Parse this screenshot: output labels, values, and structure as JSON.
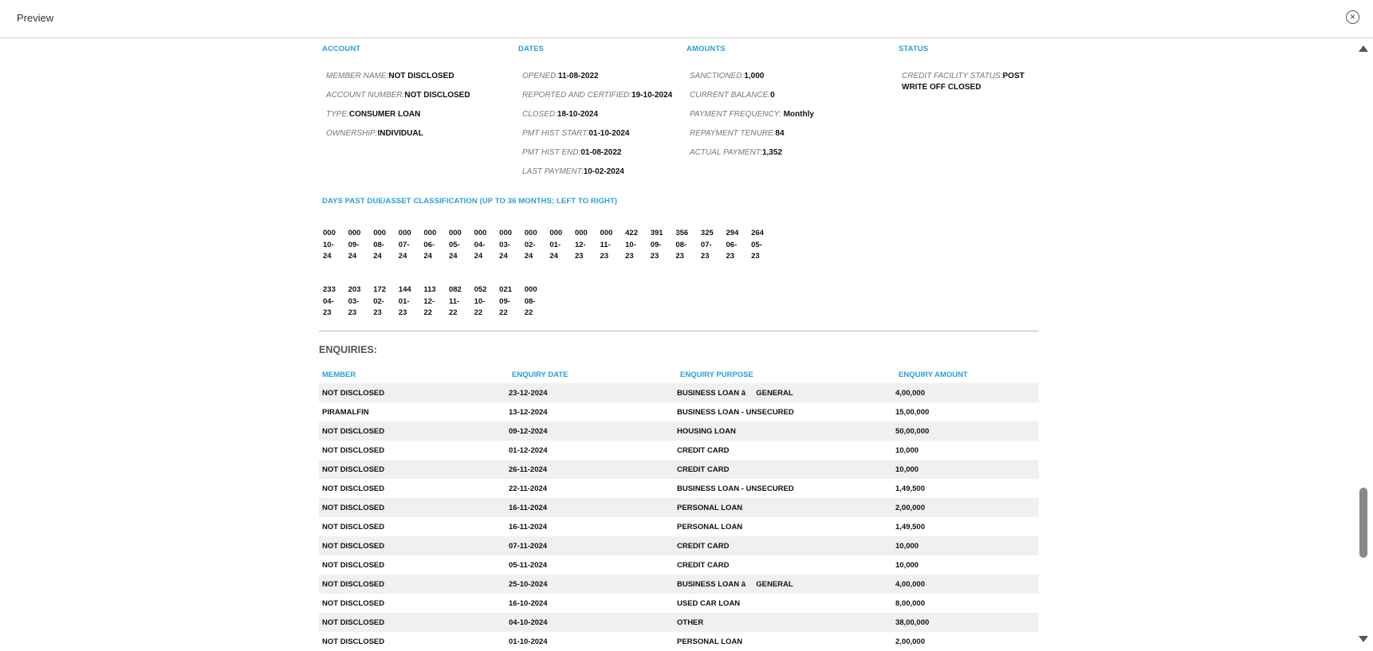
{
  "window": {
    "title": "Preview",
    "close_icon": "close-icon"
  },
  "headers": {
    "account": "ACCOUNT",
    "dates": "DATES",
    "amounts": "AMOUNTS",
    "status": "STATUS"
  },
  "account": [
    {
      "key": "MEMBER NAME:",
      "value": "NOT DISCLOSED"
    },
    {
      "key": "ACCOUNT NUMBER:",
      "value": "NOT DISCLOSED"
    },
    {
      "key": "TYPE:",
      "value": "CONSUMER LOAN"
    },
    {
      "key": "OWNERSHIP:",
      "value": "INDIVIDUAL"
    }
  ],
  "dates": [
    {
      "key": "OPENED:",
      "value": "11-08-2022"
    },
    {
      "key": "REPORTED AND CERTIFIED:",
      "value": "19-10-2024"
    },
    {
      "key": "CLOSED:",
      "value": "18-10-2024"
    },
    {
      "key": "PMT HIST START:",
      "value": "01-10-2024"
    },
    {
      "key": "PMT HIST END:",
      "value": "01-08-2022"
    },
    {
      "key": "LAST PAYMENT:",
      "value": "10-02-2024"
    }
  ],
  "amounts": [
    {
      "key": "SANCTIONED:",
      "value": "1,000"
    },
    {
      "key": "CURRENT BALANCE:",
      "value": "0"
    },
    {
      "key": "PAYMENT FREQUENCY:",
      "value": " Monthly"
    },
    {
      "key": "REPAYMENT TENURE:",
      "value": "84"
    },
    {
      "key": "ACTUAL PAYMENT:",
      "value": "1,352"
    }
  ],
  "status": {
    "key": "CREDIT FACILITY STATUS:",
    "value": "POST WRITE OFF CLOSED"
  },
  "dpd": {
    "title": "DAYS PAST DUE/ASSET CLASSIFICATION (UP TO 36 MONTHS; LEFT TO RIGHT)",
    "row1": [
      {
        "dpd": "000",
        "mm": "10-",
        "yy": "24"
      },
      {
        "dpd": "000",
        "mm": "09-",
        "yy": "24"
      },
      {
        "dpd": "000",
        "mm": "08-",
        "yy": "24"
      },
      {
        "dpd": "000",
        "mm": "07-",
        "yy": "24"
      },
      {
        "dpd": "000",
        "mm": "06-",
        "yy": "24"
      },
      {
        "dpd": "000",
        "mm": "05-",
        "yy": "24"
      },
      {
        "dpd": "000",
        "mm": "04-",
        "yy": "24"
      },
      {
        "dpd": "000",
        "mm": "03-",
        "yy": "24"
      },
      {
        "dpd": "000",
        "mm": "02-",
        "yy": "24"
      },
      {
        "dpd": "000",
        "mm": "01-",
        "yy": "24"
      },
      {
        "dpd": "000",
        "mm": "12-",
        "yy": "23"
      },
      {
        "dpd": "000",
        "mm": "11-",
        "yy": "23"
      },
      {
        "dpd": "422",
        "mm": "10-",
        "yy": "23"
      },
      {
        "dpd": "391",
        "mm": "09-",
        "yy": "23"
      },
      {
        "dpd": "356",
        "mm": "08-",
        "yy": "23"
      },
      {
        "dpd": "325",
        "mm": "07-",
        "yy": "23"
      },
      {
        "dpd": "294",
        "mm": "06-",
        "yy": "23"
      },
      {
        "dpd": "264",
        "mm": "05-",
        "yy": "23"
      }
    ],
    "row2": [
      {
        "dpd": "233",
        "mm": "04-",
        "yy": "23"
      },
      {
        "dpd": "203",
        "mm": "03-",
        "yy": "23"
      },
      {
        "dpd": "172",
        "mm": "02-",
        "yy": "23"
      },
      {
        "dpd": "144",
        "mm": "01-",
        "yy": "23"
      },
      {
        "dpd": "113",
        "mm": "12-",
        "yy": "22"
      },
      {
        "dpd": "082",
        "mm": "11-",
        "yy": "22"
      },
      {
        "dpd": "052",
        "mm": "10-",
        "yy": "22"
      },
      {
        "dpd": "021",
        "mm": "09-",
        "yy": "22"
      },
      {
        "dpd": "000",
        "mm": "08-",
        "yy": "22"
      }
    ]
  },
  "enquiries": {
    "title": "ENQUIRIES:",
    "columns": [
      "MEMBER",
      "ENQUIRY DATE",
      "ENQUIRY PURPOSE",
      "ENQUIRY AMOUNT"
    ],
    "rows": [
      [
        "NOT DISCLOSED",
        "23-12-2024",
        "BUSINESS LOAN â     GENERAL",
        "4,00,000"
      ],
      [
        "PIRAMALFIN",
        "13-12-2024",
        "BUSINESS LOAN - UNSECURED",
        "15,00,000"
      ],
      [
        "NOT DISCLOSED",
        "09-12-2024",
        "HOUSING LOAN",
        "50,00,000"
      ],
      [
        "NOT DISCLOSED",
        "01-12-2024",
        "CREDIT CARD",
        "10,000"
      ],
      [
        "NOT DISCLOSED",
        "26-11-2024",
        "CREDIT CARD",
        "10,000"
      ],
      [
        "NOT DISCLOSED",
        "22-11-2024",
        "BUSINESS LOAN - UNSECURED",
        "1,49,500"
      ],
      [
        "NOT DISCLOSED",
        "16-11-2024",
        "PERSONAL LOAN",
        "2,00,000"
      ],
      [
        "NOT DISCLOSED",
        "16-11-2024",
        "PERSONAL LOAN",
        "1,49,500"
      ],
      [
        "NOT DISCLOSED",
        "07-11-2024",
        "CREDIT CARD",
        "10,000"
      ],
      [
        "NOT DISCLOSED",
        "05-11-2024",
        "CREDIT CARD",
        "10,000"
      ],
      [
        "NOT DISCLOSED",
        "25-10-2024",
        "BUSINESS LOAN â     GENERAL",
        "4,00,000"
      ],
      [
        "NOT DISCLOSED",
        "16-10-2024",
        "USED CAR LOAN",
        "8,00,000"
      ],
      [
        "NOT DISCLOSED",
        "04-10-2024",
        "OTHER",
        "38,00,000"
      ],
      [
        "NOT DISCLOSED",
        "01-10-2024",
        "PERSONAL LOAN",
        "2,00,000"
      ]
    ]
  },
  "scrollbar": {
    "up_icon": "scroll-up-arrow-icon",
    "down_icon": "scroll-down-arrow-icon"
  }
}
